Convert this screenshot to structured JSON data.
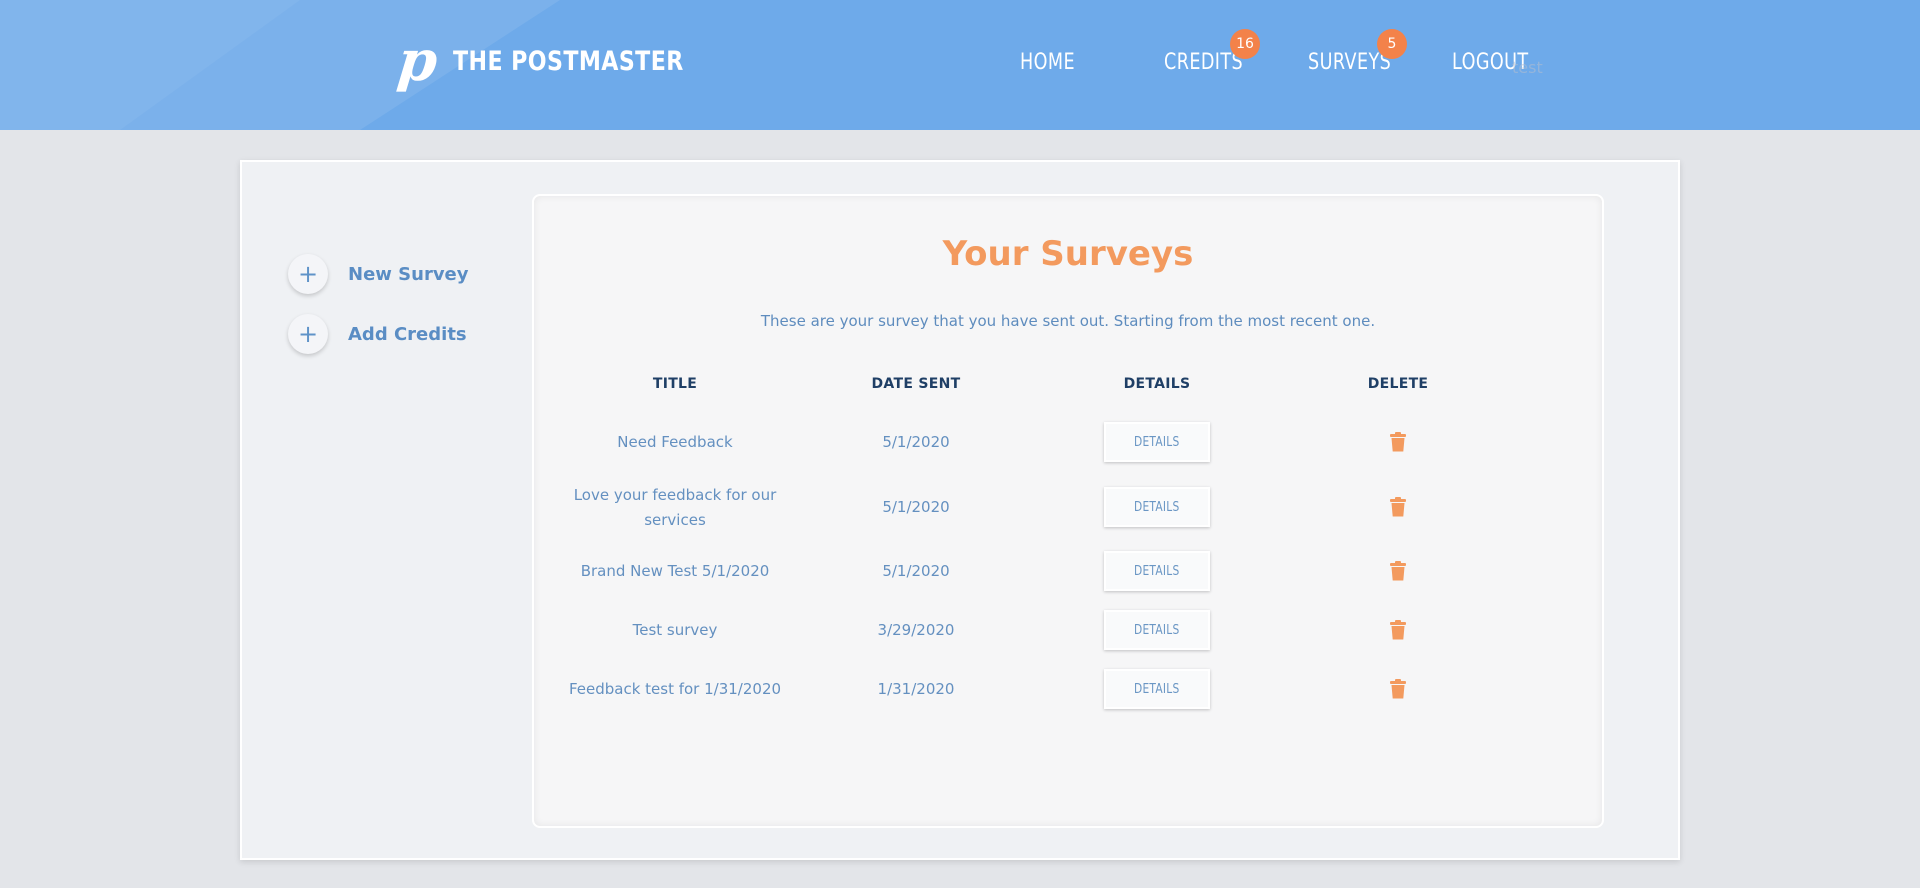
{
  "header": {
    "logo_mark": "p",
    "brand": "THE POSTMASTER",
    "nav": [
      {
        "label": "HOME"
      },
      {
        "label": "CREDITS",
        "badge": "16"
      },
      {
        "label": "SURVEYS",
        "badge": "5"
      },
      {
        "label": "LOGOUT"
      }
    ],
    "ghost_text": "test"
  },
  "sidebar": {
    "actions": [
      {
        "icon": "plus-icon",
        "label": "New Survey"
      },
      {
        "icon": "plus-icon",
        "label": "Add Credits"
      }
    ]
  },
  "main": {
    "title": "Your Surveys",
    "subtitle": "These are your survey that you have sent out. Starting from the most recent one.",
    "columns": [
      "TITLE",
      "DATE SENT",
      "DETAILS",
      "DELETE"
    ],
    "rows": [
      {
        "title": "Need Feedback",
        "date": "5/1/2020",
        "details_label": "DETAILS"
      },
      {
        "title": "Love your feedback for our services",
        "date": "5/1/2020",
        "details_label": "DETAILS"
      },
      {
        "title": "Brand New Test 5/1/2020",
        "date": "5/1/2020",
        "details_label": "DETAILS"
      },
      {
        "title": "Test survey",
        "date": "3/29/2020",
        "details_label": "DETAILS"
      },
      {
        "title": "Feedback test for 1/31/2020",
        "date": "1/31/2020",
        "details_label": "DETAILS"
      }
    ]
  },
  "colors": {
    "header_bg": "#6eaaea",
    "accent_orange": "#f39a5e",
    "badge": "#f3824a",
    "link_blue": "#5a8dc4",
    "heading_navy": "#1f3f66"
  }
}
